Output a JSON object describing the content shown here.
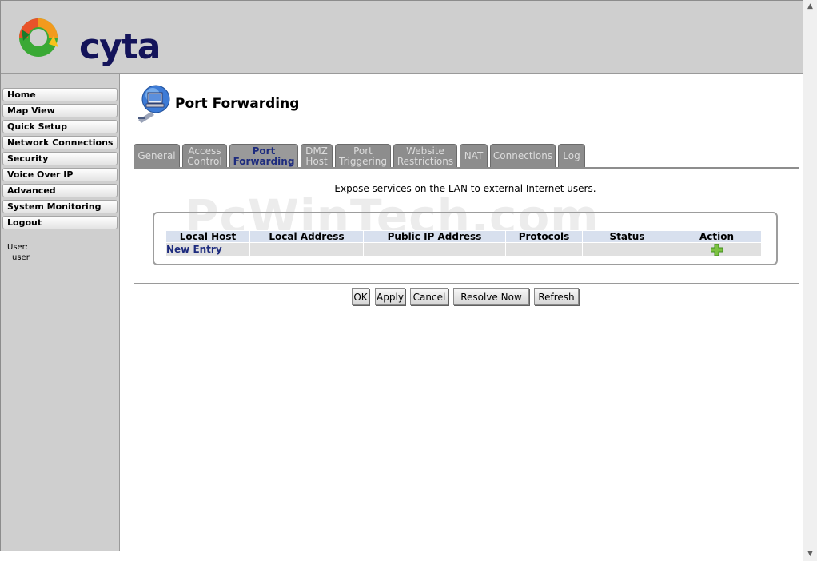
{
  "brand": {
    "name": "cyta"
  },
  "sidebar": {
    "items": [
      {
        "label": "Home"
      },
      {
        "label": "Map View"
      },
      {
        "label": "Quick Setup"
      },
      {
        "label": "Network Connections"
      },
      {
        "label": "Security"
      },
      {
        "label": "Voice Over IP"
      },
      {
        "label": "Advanced"
      },
      {
        "label": "System Monitoring"
      },
      {
        "label": "Logout"
      }
    ],
    "user_label": "User:",
    "user_value": "user"
  },
  "page": {
    "title": "Port Forwarding",
    "watermark": "PcWinTech.com",
    "description": "Expose services on the LAN to external Internet users."
  },
  "tabs": [
    {
      "line1": "General",
      "line2": ""
    },
    {
      "line1": "Access",
      "line2": "Control"
    },
    {
      "line1": "Port",
      "line2": "Forwarding",
      "active": true
    },
    {
      "line1": "DMZ",
      "line2": "Host"
    },
    {
      "line1": "Port",
      "line2": "Triggering"
    },
    {
      "line1": "Website",
      "line2": "Restrictions"
    },
    {
      "line1": "NAT",
      "line2": ""
    },
    {
      "line1": "Connections",
      "line2": ""
    },
    {
      "line1": "Log",
      "line2": ""
    }
  ],
  "table": {
    "headers": [
      "Local Host",
      "Local Address",
      "Public IP Address",
      "Protocols",
      "Status",
      "Action"
    ],
    "new_entry": "New Entry"
  },
  "buttons": {
    "ok": "OK",
    "apply": "Apply",
    "cancel": "Cancel",
    "resolve_now": "Resolve Now",
    "refresh": "Refresh"
  },
  "colors": {
    "header_bg": "#cfcfcf",
    "tab_bg": "#8d8d8d",
    "active_tab_text": "#1d2b7e",
    "table_header_bg": "#d8e0ee",
    "add_icon": "#7cc242"
  },
  "icons": {
    "logo": "cyta-swirl-logo",
    "page": "port-forwarding-computer-icon",
    "add": "green-plus-icon"
  }
}
